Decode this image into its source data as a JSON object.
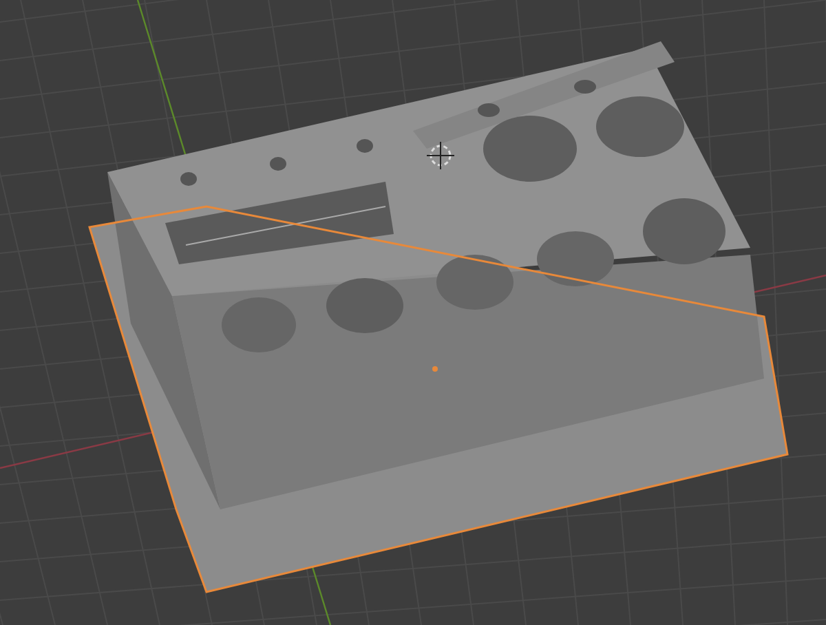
{
  "viewport": {
    "model": {
      "selected": true
    }
  }
}
